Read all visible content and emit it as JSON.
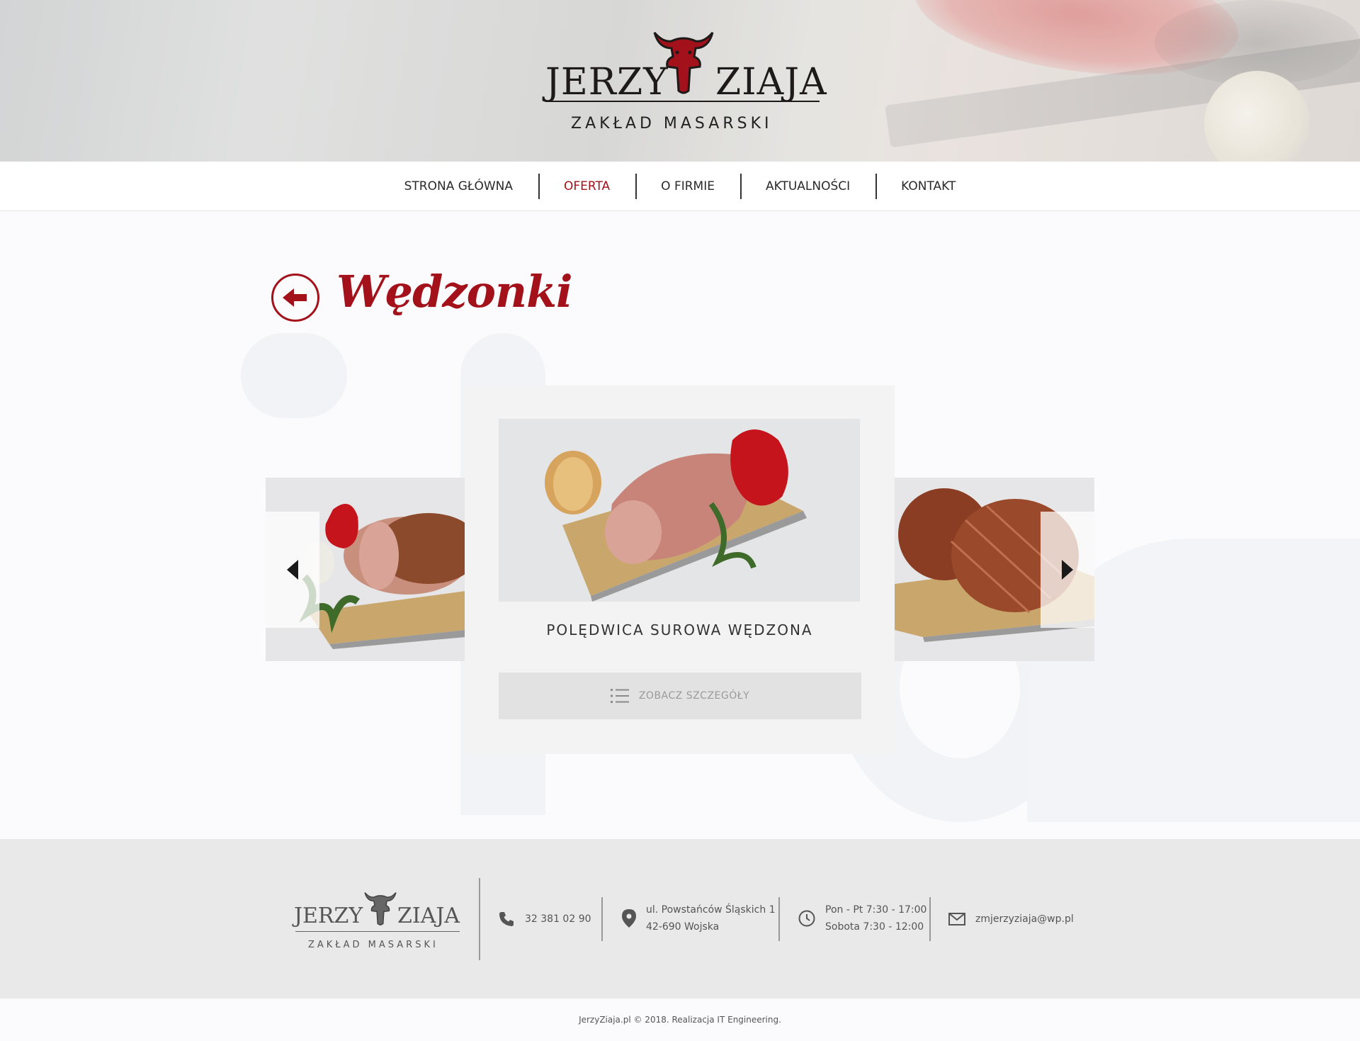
{
  "brand": {
    "name_left": "JERZY",
    "name_right": "ZIAJA",
    "subtitle": "ZAKŁAD MASARSKI"
  },
  "nav": {
    "items": [
      {
        "label": "STRONA GŁÓWNA"
      },
      {
        "label": "OFERTA"
      },
      {
        "label": "O FIRMIE"
      },
      {
        "label": "AKTUALNOŚCI"
      },
      {
        "label": "KONTAKT"
      }
    ],
    "active_index": 1
  },
  "page": {
    "title": "Wędzonki"
  },
  "carousel": {
    "current_product": "POLĘDWICA SUROWA WĘDZONA",
    "details_label": "ZOBACZ SZCZEGÓŁY"
  },
  "footer": {
    "phone": "32 381 02 90",
    "address_line1": "ul. Powstańców Śląskich 1",
    "address_line2": "42-690 Wojska",
    "hours_line1": "Pon - Pt 7:30 - 17:00",
    "hours_line2": "Sobota  7:30 - 12:00",
    "email": "zmjerzyziaja@wp.pl",
    "copyright": "JerzyZiaja.pl © 2018.  Realizacja IT Engineering."
  },
  "colors": {
    "accent": "#a3111a",
    "footer_bg": "#e9e9ea"
  }
}
